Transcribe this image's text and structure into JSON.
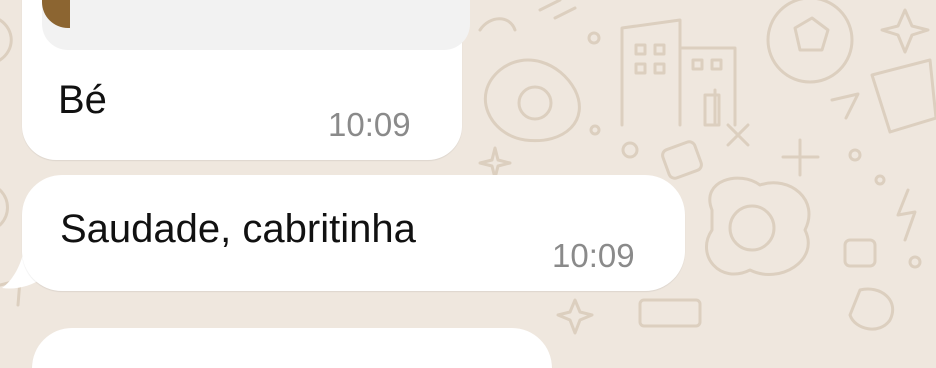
{
  "chat": {
    "messages": [
      {
        "quoted_text": "...",
        "text": "Bé",
        "time": "10:09"
      },
      {
        "text": "Saudade, cabritinha",
        "time": "10:09"
      },
      {
        "text": ""
      }
    ],
    "colors": {
      "wallpaper": "#efe7de",
      "doodle": "#dccfbf",
      "bubble": "#ffffff",
      "quote_background": "#f2f2f2",
      "thumbnail": "#8c6531",
      "timestamp": "#8a8a8a"
    }
  }
}
